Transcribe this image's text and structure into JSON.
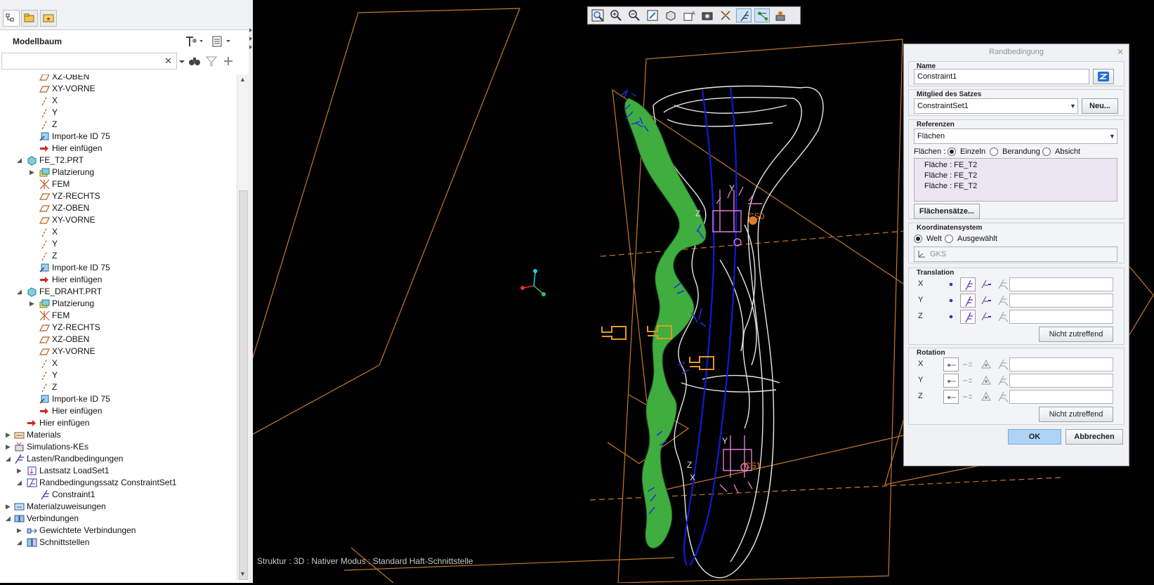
{
  "tree_panel": {
    "title": "Modellbaum",
    "search": {
      "value": "",
      "placeholder": ""
    }
  },
  "tree_items": [
    {
      "label": "XZ-OBEN",
      "icon": "datum-plane-icon",
      "level": 2,
      "expander": ""
    },
    {
      "label": "XY-VORNE",
      "icon": "datum-plane-icon",
      "level": 2,
      "expander": ""
    },
    {
      "label": "X",
      "icon": "datum-axis-icon",
      "level": 2,
      "expander": ""
    },
    {
      "label": "Y",
      "icon": "datum-axis-icon",
      "level": 2,
      "expander": ""
    },
    {
      "label": "Z",
      "icon": "datum-axis-icon",
      "level": 2,
      "expander": ""
    },
    {
      "label": "Import-ke ID 75",
      "icon": "import-feature-icon",
      "level": 2,
      "expander": ""
    },
    {
      "label": "Hier einfügen",
      "icon": "insert-here-arrow-icon",
      "level": 2,
      "expander": ""
    },
    {
      "label": "FE_T2.PRT",
      "icon": "part-icon",
      "level": 1,
      "expander": "open"
    },
    {
      "label": "Platzierung",
      "icon": "placement-icon",
      "level": 2,
      "expander": "closed"
    },
    {
      "label": "FEM",
      "icon": "fem-icon",
      "level": 2,
      "expander": ""
    },
    {
      "label": "YZ-RECHTS",
      "icon": "datum-plane-icon",
      "level": 2,
      "expander": ""
    },
    {
      "label": "XZ-OBEN",
      "icon": "datum-plane-icon",
      "level": 2,
      "expander": ""
    },
    {
      "label": "XY-VORNE",
      "icon": "datum-plane-icon",
      "level": 2,
      "expander": ""
    },
    {
      "label": "X",
      "icon": "datum-axis-icon",
      "level": 2,
      "expander": ""
    },
    {
      "label": "Y",
      "icon": "datum-axis-icon",
      "level": 2,
      "expander": ""
    },
    {
      "label": "Z",
      "icon": "datum-axis-icon",
      "level": 2,
      "expander": ""
    },
    {
      "label": "Import-ke ID 75",
      "icon": "import-feature-icon",
      "level": 2,
      "expander": ""
    },
    {
      "label": "Hier einfügen",
      "icon": "insert-here-arrow-icon",
      "level": 2,
      "expander": ""
    },
    {
      "label": "FE_DRAHT.PRT",
      "icon": "part-icon",
      "level": 1,
      "expander": "open"
    },
    {
      "label": "Platzierung",
      "icon": "placement-icon",
      "level": 2,
      "expander": "closed"
    },
    {
      "label": "FEM",
      "icon": "fem-icon",
      "level": 2,
      "expander": ""
    },
    {
      "label": "YZ-RECHTS",
      "icon": "datum-plane-icon",
      "level": 2,
      "expander": ""
    },
    {
      "label": "XZ-OBEN",
      "icon": "datum-plane-icon",
      "level": 2,
      "expander": ""
    },
    {
      "label": "XY-VORNE",
      "icon": "datum-plane-icon",
      "level": 2,
      "expander": ""
    },
    {
      "label": "X",
      "icon": "datum-axis-icon",
      "level": 2,
      "expander": ""
    },
    {
      "label": "Y",
      "icon": "datum-axis-icon",
      "level": 2,
      "expander": ""
    },
    {
      "label": "Z",
      "icon": "datum-axis-icon",
      "level": 2,
      "expander": ""
    },
    {
      "label": "Import-ke ID 75",
      "icon": "import-feature-icon",
      "level": 2,
      "expander": ""
    },
    {
      "label": "Hier einfügen",
      "icon": "insert-here-arrow-icon",
      "level": 2,
      "expander": ""
    },
    {
      "label": "Hier einfügen",
      "icon": "insert-here-arrow-icon",
      "level": 1,
      "expander": ""
    },
    {
      "label": "Materials",
      "icon": "materials-icon",
      "level": 0,
      "expander": "closed"
    },
    {
      "label": "Simulations-KEs",
      "icon": "simulation-features-icon",
      "level": 0,
      "expander": "closed"
    },
    {
      "label": "Lasten/Randbedingungen",
      "icon": "loads-constraints-icon",
      "level": 0,
      "expander": "open"
    },
    {
      "label": "Lastsatz LoadSet1",
      "icon": "load-set-icon",
      "level": 1,
      "expander": "closed"
    },
    {
      "label": "Randbedingungssatz ConstraintSet1",
      "icon": "constraint-set-icon",
      "level": 1,
      "expander": "open"
    },
    {
      "label": "Constraint1",
      "icon": "constraint-icon",
      "level": 2,
      "expander": ""
    },
    {
      "label": "Materialzuweisungen",
      "icon": "material-assignment-icon",
      "level": 0,
      "expander": "closed"
    },
    {
      "label": "Verbindungen",
      "icon": "connections-icon",
      "level": 0,
      "expander": "open"
    },
    {
      "label": "Gewichtete Verbindungen",
      "icon": "weighted-link-icon",
      "level": 1,
      "expander": "closed"
    },
    {
      "label": "Schnittstellen",
      "icon": "interfaces-icon",
      "level": 1,
      "expander": "open"
    }
  ],
  "viewport": {
    "status": "Struktur : 3D : Nativer Modus : Standard Haft-Schnittstelle",
    "labels": {
      "y_top": "Y",
      "z_top": "Z",
      "csys_top": "CS0",
      "y_bottom": "Y",
      "z_bottom": "Z",
      "x_bottom": "X",
      "csys_bottom": "CS1"
    },
    "toolbar": [
      "zoom-fit-icon",
      "zoom-in-icon",
      "zoom-out-icon",
      "repaint-icon",
      "display-style-icon",
      "saved-views-icon",
      "view-manager-icon",
      "datum-display-icon",
      "constraint-display-icon",
      "connection-display-icon",
      "annotation-display-icon"
    ]
  },
  "dialog": {
    "title": "Randbedingung",
    "name_label": "Name",
    "name_value": "Constraint1",
    "member_label": "Mitglied des Satzes",
    "member_value": "ConstraintSet1",
    "new_button": "Neu...",
    "references_label": "Referenzen",
    "references_value": "Flächen",
    "surfaces_label": "Flächen :",
    "radio_single": "Einzeln",
    "radio_boundary": "Berandung",
    "radio_offset": "Absicht",
    "surface_list": [
      "Fläche : FE_T2",
      "Fläche : FE_T2",
      "Fläche : FE_T2"
    ],
    "surface_sets_button": "Flächensätze...",
    "csys_label": "Koordinatensystem",
    "csys_world": "Welt",
    "csys_selected": "Ausgewählt",
    "csys_value": "GKS",
    "translation_label": "Translation",
    "rotation_label": "Rotation",
    "axes": [
      "X",
      "Y",
      "Z"
    ],
    "not_applicable": "Nicht zutreffend",
    "ok": "OK",
    "cancel": "Abbrechen"
  },
  "colors": {
    "accent_blue": "#1f6fd6",
    "constraint_pink": "#e07ad0",
    "part_green": "#3fae3f",
    "datum_orange": "#d97b1a",
    "wire_blue": "#0d1bd8"
  }
}
